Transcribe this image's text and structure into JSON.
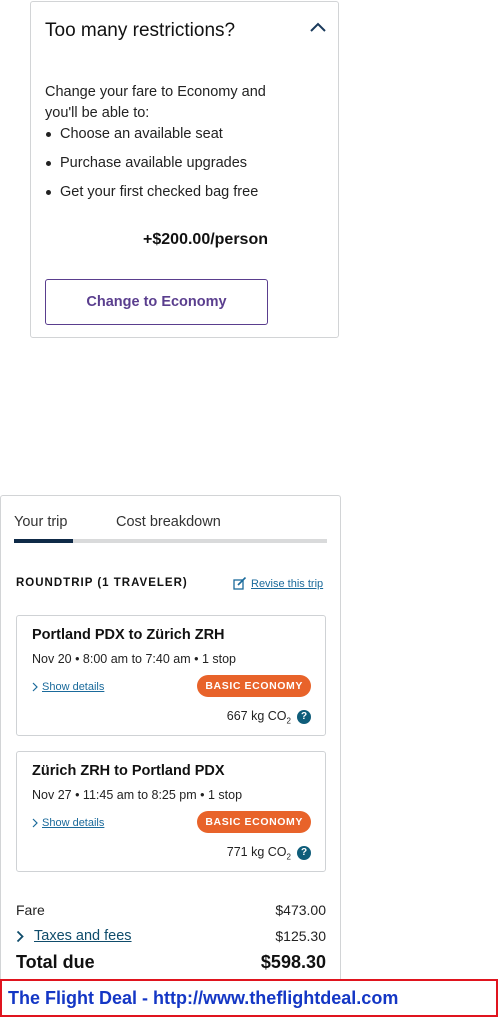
{
  "upsell": {
    "title": "Too many restrictions?",
    "intro": "Change your fare to Economy and you'll be able to:",
    "benefits": [
      "Choose an available seat",
      "Purchase available upgrades",
      "Get your first checked bag free"
    ],
    "price": "+$200.00/person",
    "button_label": "Change to Economy",
    "collapse_icon": "chevron-up-icon",
    "button_color": "#5a3e8e"
  },
  "trip": {
    "tabs": [
      {
        "label": "Your trip",
        "active": true
      },
      {
        "label": "Cost breakdown",
        "active": false
      }
    ],
    "trip_type": "ROUNDTRIP (1 TRAVELER)",
    "revise_label": "Revise this trip",
    "flights": [
      {
        "route": "Portland PDX to Zürich ZRH",
        "times": "Nov 20 • 8:00 am to 7:40 am • 1 stop",
        "details_label": "Show details",
        "fare_class": "BASIC ECONOMY",
        "co2_value": "667 kg CO",
        "co2_sub": "2"
      },
      {
        "route": "Zürich ZRH to Portland PDX",
        "times": "Nov 27 • 11:45 am to 8:25 pm • 1 stop",
        "details_label": "Show details",
        "fare_class": "BASIC ECONOMY",
        "co2_value": "771 kg CO",
        "co2_sub": "2"
      }
    ],
    "summary": {
      "fare_label": "Fare",
      "fare_value": "$473.00",
      "taxes_label": "Taxes and fees",
      "taxes_value": "$125.30",
      "total_label": "Total due",
      "total_value": "$598.30"
    },
    "badge_color": "#e8632a",
    "active_tab_color": "#0f2a47"
  },
  "banner": {
    "text": "The Flight Deal - http://www.theflightdeal.com",
    "text_color": "#1437c5",
    "border_color": "#e0141e"
  }
}
